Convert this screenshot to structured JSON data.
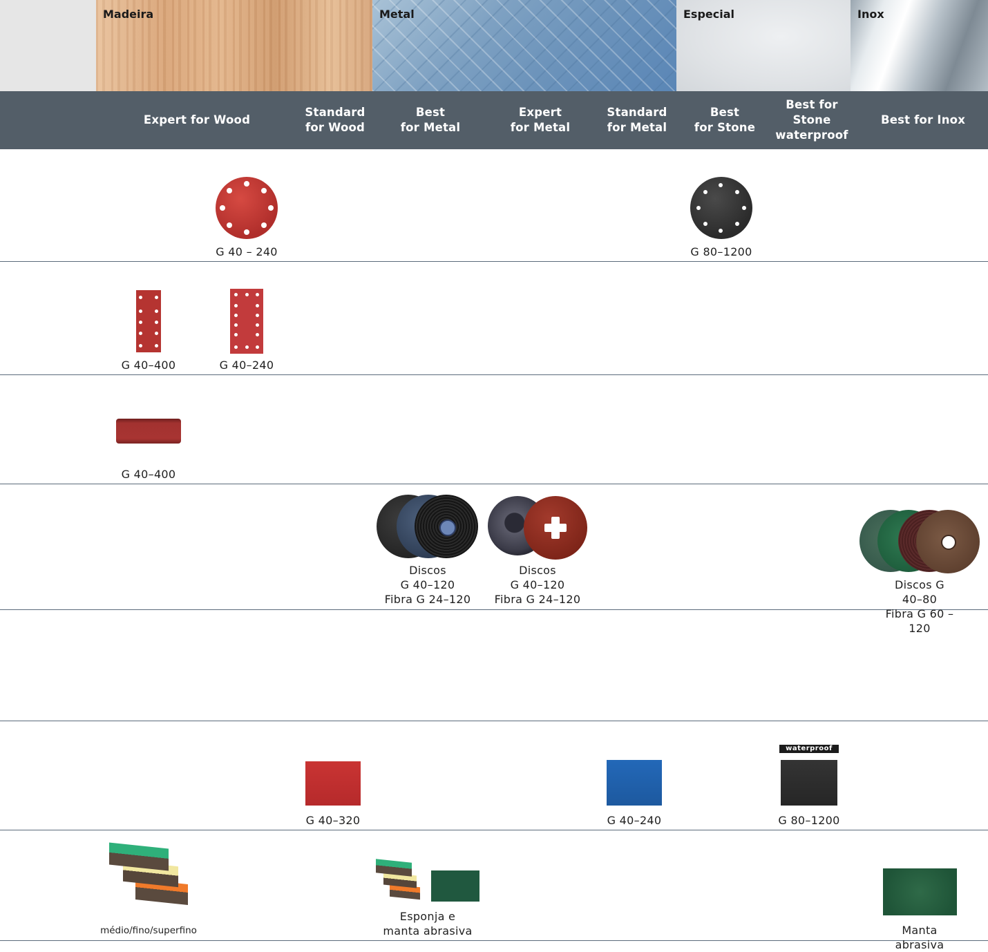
{
  "materials": {
    "madeira": "Madeira",
    "metal": "Metal",
    "especial": "Especial",
    "inox": "Inox"
  },
  "columns": [
    "Expert for Wood",
    "Standard\nfor Wood",
    "Best\nfor Metal",
    "Expert\nfor Metal",
    "Standard\nfor Metal",
    "Best\nfor Stone",
    "Best for\nStone\nwaterproof",
    "Best for Inox"
  ],
  "rows": {
    "disc": {
      "expert_wood": "G 40 – 240",
      "best_stone": "G 80–1200"
    },
    "sheets": {
      "small": "G 40–400",
      "large": "G 40–240"
    },
    "belt": {
      "expert_wood": "G 40–400"
    },
    "fibre": {
      "best_metal": "Discos\nG 40–120\nFibra G 24–120",
      "expert_metal": "Discos\nG 40–120\nFibra G 24–120",
      "best_inox": "Discos G 40–80\nFibra G 60 –120"
    },
    "paper": {
      "standard_wood": "G 40–320",
      "standard_metal": "G 40–240",
      "stone_waterproof": "G 80–1200",
      "waterproof_tag": "waterproof"
    },
    "sponge": {
      "expert_wood": "médio/fino/superfino",
      "best_metal": "Esponja e\nmanta abrasiva",
      "best_inox": "Manta abrasiva"
    }
  },
  "colors": {
    "header": "#535e68",
    "red": "#b83131",
    "dark": "#2f2f2f",
    "blue": "#1f5fa8",
    "green": "#2e5a3f"
  }
}
